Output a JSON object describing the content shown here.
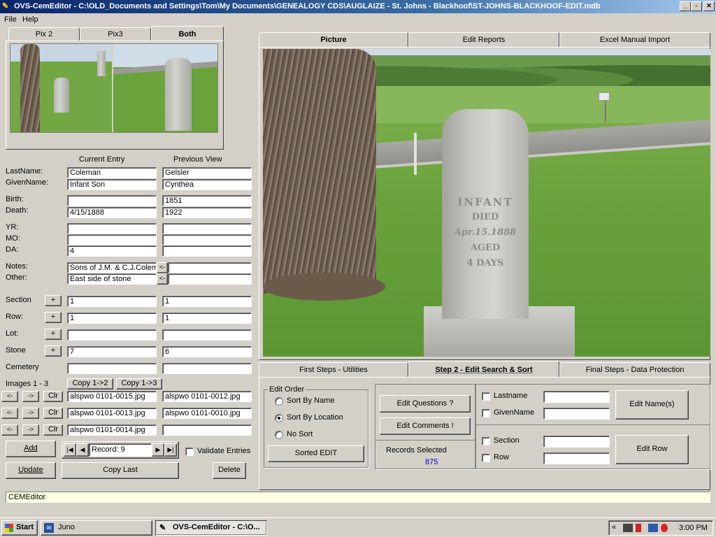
{
  "window": {
    "title": "OVS-CemEditor - C:\\OLD_Documents and Settings\\Tom\\My Documents\\GENEALOGY CDS\\AUGLAIZE - St. Johns - Blackhoof\\ST-JOHNS-BLACKHOOF-EDIT.mdb",
    "minimize": "_",
    "maximize": "▫",
    "close": "✕"
  },
  "menu": {
    "file": "File",
    "help": "Help"
  },
  "thumb_tabs": [
    "Pix 2",
    "Pix3",
    "Both"
  ],
  "form": {
    "current_header": "Current Entry",
    "previous_header": "Previous View",
    "labels": {
      "lastname": "LastName:",
      "givenname": "GivenName:",
      "birth": "Birth:",
      "death": "Death:",
      "yr": "YR:",
      "mo": "MO:",
      "da": "DA:",
      "notes": "Notes:",
      "other": "Other:",
      "section": "Section",
      "row": "Row:",
      "lot": "Lot:",
      "stone": "Stone",
      "cemetery": "Cemetery",
      "images": "Images 1 - 3"
    },
    "current": {
      "lastname": "Coleman",
      "givenname": "Infant Son",
      "birth": "",
      "death": "4/15/1888",
      "yr": "",
      "mo": "",
      "da": "4",
      "notes": "Sons of J.M. & C.J.Colem",
      "other": "East side of stone",
      "section": "1",
      "row": "1",
      "lot": "",
      "stone": "7",
      "cemetery": "",
      "image1": "alspwo 0101-0015.jpg",
      "image2": "alspwo 0101-0013.jpg",
      "image3": "alspwo 0101-0014.jpg"
    },
    "previous": {
      "lastname": "Gelsler",
      "givenname": "Cynthea",
      "birth": "1851",
      "death": "1922",
      "yr": "",
      "mo": "",
      "da": "",
      "notes": "",
      "other": "",
      "section": "1",
      "row": "1",
      "lot": "",
      "stone": "6",
      "cemetery": "",
      "image1": "alspwo 0101-0012.jpg",
      "image2": "alspwo 0101-0010.jpg",
      "image3": ""
    },
    "plus": "+",
    "copy_left": "<-",
    "copy_1_2": "Copy 1->2",
    "copy_1_3": "Copy 1->3",
    "prev_img": "<-",
    "next_img": "->",
    "clear": "Clr"
  },
  "actions": {
    "add": "Add",
    "update": "Update",
    "copy_last": "Copy Last",
    "delete": "Delete",
    "validate": "Validate Entries",
    "record_label": "Record: 9",
    "nav_first": "|◀",
    "nav_prev": "◀",
    "nav_next": "▶",
    "nav_last": "▶|"
  },
  "main_tabs": [
    "Picture",
    "Edit Reports",
    "Excel Manual Import"
  ],
  "photo_text": [
    "INFANT",
    "DIED",
    "Apr.15.1888",
    "AGED",
    "4 DAYS"
  ],
  "bottom_tabs": [
    "First Steps - Utilities",
    "Step 2 - Edit Search & Sort",
    "Final Steps - Data Protection"
  ],
  "edit_order": {
    "title": "Edit Order",
    "options": [
      "Sort By Name",
      "Sort By Location",
      "No Sort"
    ],
    "selected": 1,
    "sorted_edit": "Sorted EDIT"
  },
  "edit_buttons": {
    "questions": "Edit Questions ?",
    "comments": "Edit Comments !"
  },
  "records": {
    "label": "Records Selected",
    "count": "875"
  },
  "search": {
    "lastname": "Lastname",
    "givenname": "GivenName",
    "edit_names": "Edit Name(s)",
    "section": "Section",
    "row": "Row",
    "edit_row": "Edit Row"
  },
  "status": "CEMEditor",
  "taskbar": {
    "start": "Start",
    "task1": "Juno",
    "task2": "OVS-CemEditor - C:\\O...",
    "tray_arrows": "«",
    "clock": "3:00 PM"
  },
  "colors": {
    "title_bar": "#0a246a",
    "records_count": "#0000cc",
    "status_bg": "#ffffe1"
  }
}
